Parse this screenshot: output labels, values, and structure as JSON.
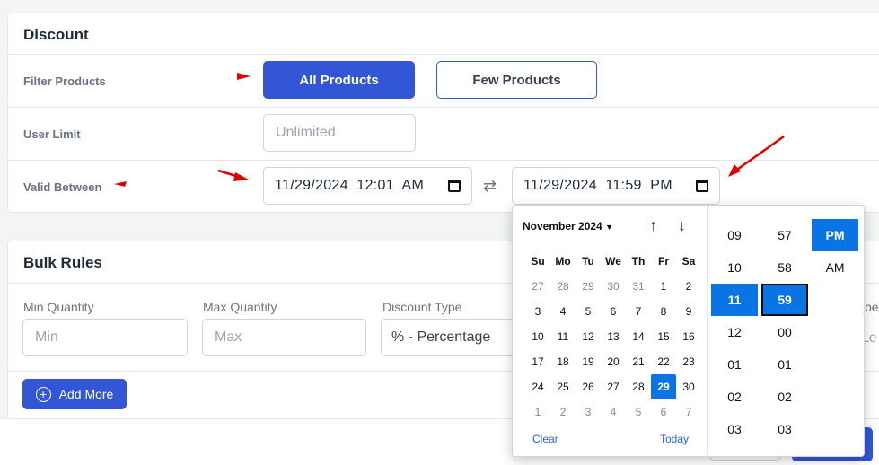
{
  "discount": {
    "title": "Discount",
    "filter_label": "Filter Products",
    "all_products": "All Products",
    "few_products": "Few Products",
    "user_limit_label": "User Limit",
    "user_limit_placeholder": "Unlimited",
    "valid_between_label": "Valid Between",
    "start_datetime": "11/29/2024  12:01  AM",
    "end_datetime": "11/29/2024  11:59  PM"
  },
  "bulk": {
    "title": "Bulk Rules",
    "min_quantity_label": "Min Quantity",
    "min_placeholder": "Min",
    "max_quantity_label": "Max Quantity",
    "max_placeholder": "Max",
    "discount_type_label": "Discount Type",
    "discount_type_value": "% - Percentage",
    "add_more": "Add More",
    "clipped_label_fragment": "be",
    "clipped_value_fragment": "t Le"
  },
  "picker": {
    "month": "November 2024",
    "weekdays": [
      "Su",
      "Mo",
      "Tu",
      "We",
      "Th",
      "Fr",
      "Sa"
    ],
    "weeks": [
      [
        "27",
        "28",
        "29",
        "30",
        "31",
        "1",
        "2"
      ],
      [
        "3",
        "4",
        "5",
        "6",
        "7",
        "8",
        "9"
      ],
      [
        "10",
        "11",
        "12",
        "13",
        "14",
        "15",
        "16"
      ],
      [
        "17",
        "18",
        "19",
        "20",
        "21",
        "22",
        "23"
      ],
      [
        "24",
        "25",
        "26",
        "27",
        "28",
        "29",
        "30"
      ],
      [
        "1",
        "2",
        "3",
        "4",
        "5",
        "6",
        "7"
      ]
    ],
    "selected_day": "29",
    "clear": "Clear",
    "today": "Today",
    "hours": [
      "09",
      "10",
      "11",
      "12",
      "01",
      "02",
      "03"
    ],
    "selected_hour": "11",
    "minutes": [
      "57",
      "58",
      "59",
      "00",
      "01",
      "02",
      "03"
    ],
    "selected_minute": "59",
    "meridiem": [
      "PM",
      "AM"
    ],
    "selected_meridiem": "PM"
  },
  "colors": {
    "primary": "#3256d6",
    "picker_selected": "#0b74e5",
    "annotation_arrow": "#e00000"
  }
}
